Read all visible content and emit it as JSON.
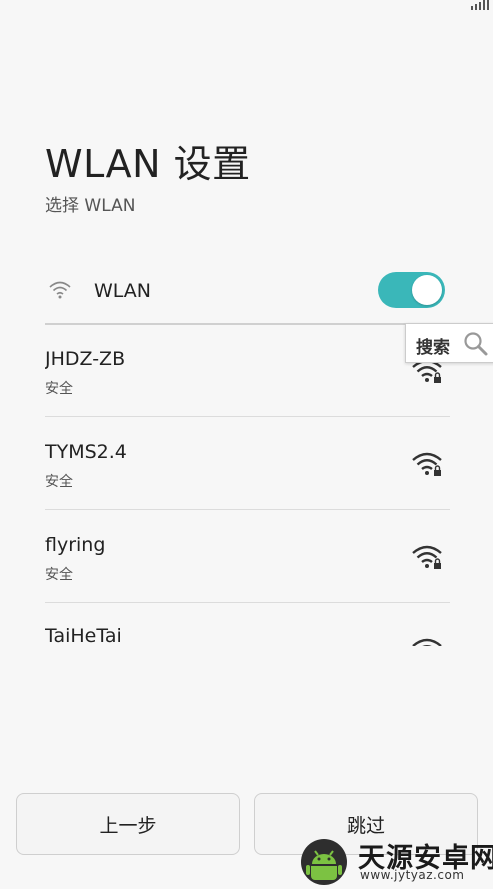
{
  "header": {
    "title": "WLAN 设置",
    "subtitle": "选择 WLAN"
  },
  "wlan": {
    "label": "WLAN",
    "enabled": true,
    "accent_color": "#3ab7b9"
  },
  "networks": [
    {
      "ssid": "JHDZ-ZB",
      "security": "安全",
      "icon": "wifi-lock-icon"
    },
    {
      "ssid": "TYMS2.4",
      "security": "安全",
      "icon": "wifi-lock-icon"
    },
    {
      "ssid": "flyring",
      "security": "安全",
      "icon": "wifi-lock-icon"
    },
    {
      "ssid": "TaiHeTai",
      "security": "",
      "icon": "wifi-lock-icon"
    }
  ],
  "search_tip": {
    "label": "搜索",
    "icon": "search-icon"
  },
  "buttons": {
    "back_label": "上一步",
    "skip_label": "跳过"
  },
  "watermark": {
    "name": "天源安卓网",
    "url": "www.jytyaz.com"
  }
}
